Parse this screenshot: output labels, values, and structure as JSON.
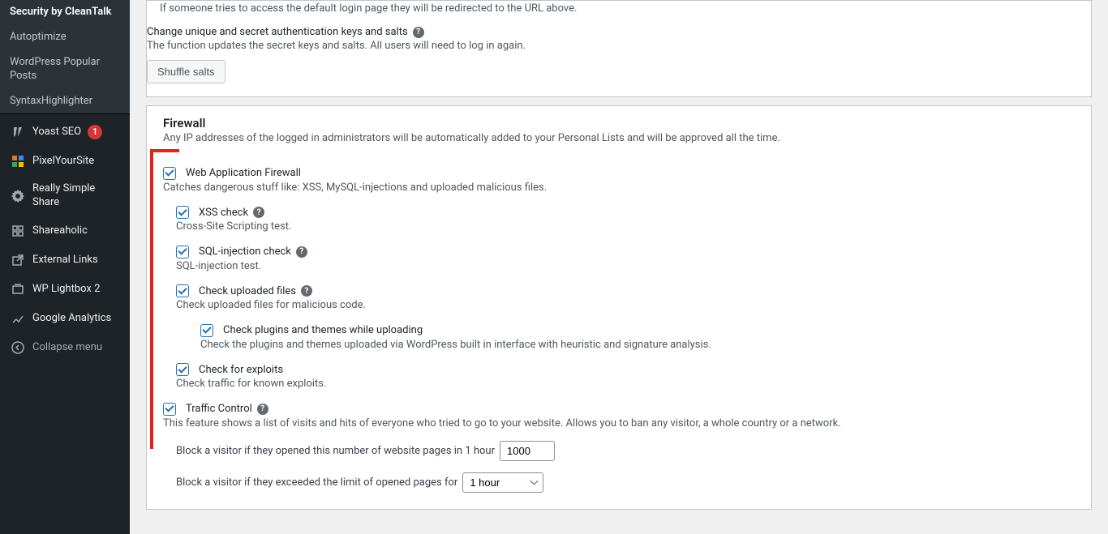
{
  "sidebar": {
    "items": [
      {
        "label": "Security by CleanTalk",
        "type": "sub-active"
      },
      {
        "label": "Autoptimize",
        "type": "sub"
      },
      {
        "label": "WordPress Popular Posts",
        "type": "sub"
      },
      {
        "label": "SyntaxHighlighter",
        "type": "sub"
      },
      {
        "label": "Yoast SEO",
        "icon": "yoast",
        "badge": "1"
      },
      {
        "label": "PixelYourSite",
        "icon": "pixel"
      },
      {
        "label": "Really Simple Share",
        "icon": "gear"
      },
      {
        "label": "Shareaholic",
        "icon": "share"
      },
      {
        "label": "External Links",
        "icon": "external"
      },
      {
        "label": "WP Lightbox 2",
        "icon": "lightbox"
      },
      {
        "label": "Google Analytics",
        "icon": "analytics"
      },
      {
        "label": "Collapse menu",
        "icon": "collapse"
      }
    ]
  },
  "misc": {
    "redirect_desc": "If someone tries to access the default login page they will be redirected to the URL above.",
    "auth_keys_label": "Change unique and secret authentication keys and salts",
    "auth_keys_desc": "The function updates the secret keys and salts. All users will need to log in again.",
    "shuffle_btn": "Shuffle salts"
  },
  "firewall": {
    "title": "Firewall",
    "subtitle": "Any IP addresses of the logged in administrators will be automatically added to your Personal Lists and will be approved all the time.",
    "waf": {
      "label": "Web Application Firewall",
      "desc": "Catches dangerous stuff like: XSS, MySQL-injections and uploaded malicious files."
    },
    "xss": {
      "label": "XSS check",
      "desc": "Cross-Site Scripting test."
    },
    "sql": {
      "label": "SQL-injection check",
      "desc": "SQL-injection test."
    },
    "uploads": {
      "label": "Check uploaded files",
      "desc": "Check uploaded files for malicious code."
    },
    "plugins": {
      "label": "Check plugins and themes while uploading",
      "desc": "Check the plugins and themes uploaded via WordPress built in interface with heuristic and signature analysis."
    },
    "exploits": {
      "label": "Check for exploits",
      "desc": "Check traffic for known exploits."
    },
    "traffic": {
      "label": "Traffic Control",
      "desc": "This feature shows a list of visits and hits of everyone who tried to go to your website. Allows you to ban any visitor, a whole country or a network."
    },
    "block_pages_label": "Block a visitor if they opened this number of website pages in 1 hour",
    "block_pages_value": "1000",
    "block_time_label": "Block a visitor if they exceeded the limit of opened pages for",
    "block_time_value": "1 hour"
  }
}
